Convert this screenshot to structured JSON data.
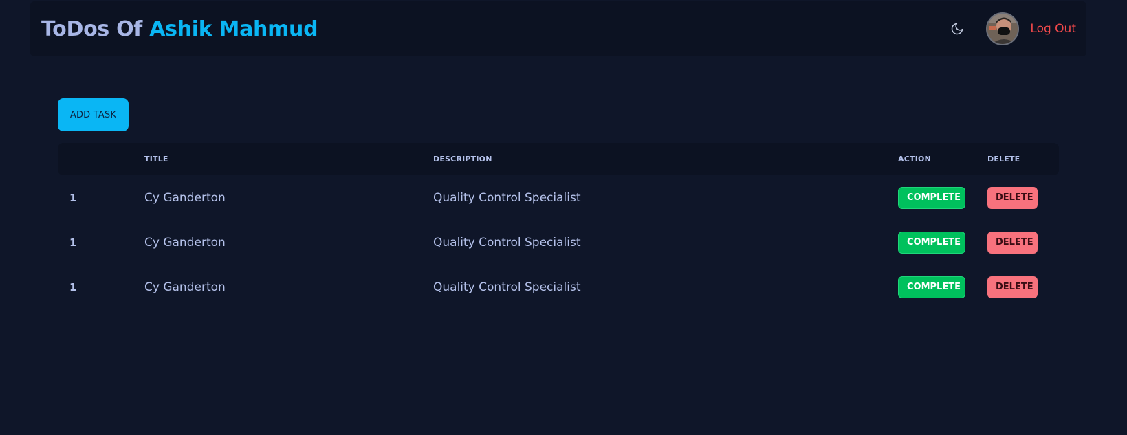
{
  "header": {
    "brand_prefix": "ToDos Of",
    "brand_name": "Ashik Mahmud",
    "logout_label": "Log Out"
  },
  "toolbar": {
    "add_task_label": "ADD TASK"
  },
  "table": {
    "columns": [
      "",
      "TITLE",
      "DESCRIPTION",
      "ACTION",
      "DELETE"
    ],
    "rows": [
      {
        "num": "1",
        "title": "Cy Ganderton",
        "description": "Quality Control Specialist",
        "action": "COMPLETE",
        "delete": "DELETE"
      },
      {
        "num": "1",
        "title": "Cy Ganderton",
        "description": "Quality Control Specialist",
        "action": "COMPLETE",
        "delete": "DELETE"
      },
      {
        "num": "1",
        "title": "Cy Ganderton",
        "description": "Quality Control Specialist",
        "action": "COMPLETE",
        "delete": "DELETE"
      }
    ]
  },
  "colors": {
    "background": "#0f1629",
    "accent": "#0ab6f4",
    "complete": "#00c15d",
    "delete": "#f8727d",
    "logout": "#f0484a"
  },
  "icons": {
    "theme_toggle": "moon-icon",
    "avatar": "avatar"
  }
}
